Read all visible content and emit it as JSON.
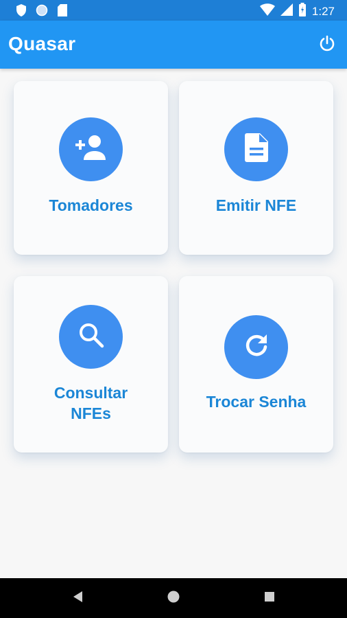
{
  "status_bar": {
    "time": "1:27",
    "left_icons": [
      "shield-icon",
      "circle-icon",
      "sd-card-icon"
    ],
    "right_icons": [
      "wifi-icon",
      "signal-icon",
      "battery-icon"
    ]
  },
  "app_bar": {
    "title": "Quasar",
    "action_icon": "power-icon",
    "color": "#2196f3"
  },
  "menu": {
    "items": [
      {
        "id": "tomadores",
        "label": "Tomadores",
        "icon": "person-add-icon"
      },
      {
        "id": "emitir-nfe",
        "label": "Emitir NFE",
        "icon": "document-icon"
      },
      {
        "id": "consultar-nfes",
        "label": "Consultar\nNFEs",
        "label_line1": "Consultar",
        "label_line2": "NFEs",
        "icon": "search-icon"
      },
      {
        "id": "trocar-senha",
        "label": "Trocar Senha",
        "icon": "refresh-icon"
      }
    ],
    "accent_color": "#3f8ff0",
    "label_color": "#1b86d6"
  },
  "nav_bar": {
    "buttons": [
      "back-icon",
      "home-icon",
      "recents-icon"
    ]
  }
}
